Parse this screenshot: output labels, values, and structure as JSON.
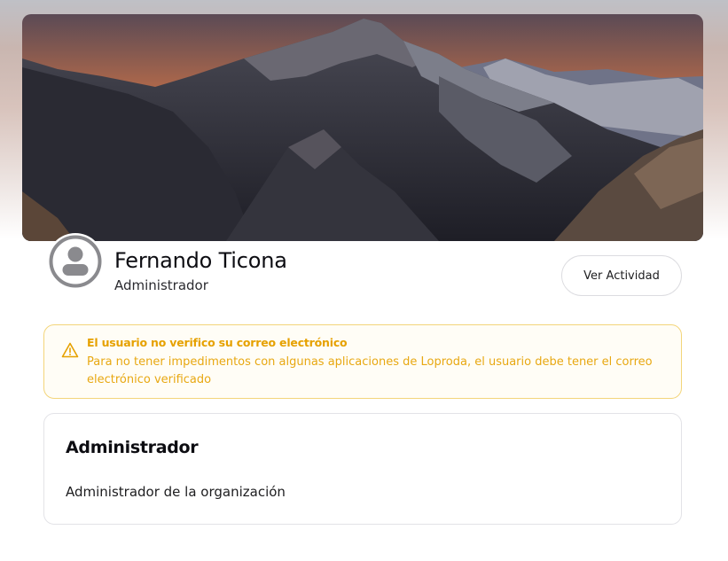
{
  "profile": {
    "name": "Fernando Ticona",
    "role": "Administrador",
    "activity_button": "Ver Actividad"
  },
  "alert": {
    "icon": "warning-icon",
    "title": "El usuario no verifico su correo electrónico",
    "message": "Para no tener impedimentos con algunas aplicaciones de Loproda, el usuario debe tener el correo electrónico verificado"
  },
  "role_card": {
    "title": "Administrador",
    "description": "Administrador de la organización"
  },
  "colors": {
    "warning": "#e6a100",
    "warning_border": "#f3d57a",
    "avatar_gray": "#8a8a8e"
  }
}
